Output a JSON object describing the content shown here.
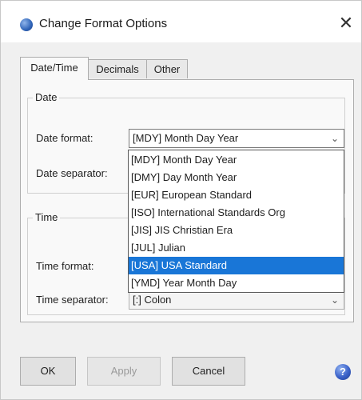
{
  "window": {
    "title": "Change Format Options",
    "close_glyph": "✕",
    "app_icon": "app-globe-icon"
  },
  "tabs": [
    {
      "label": "Date/Time",
      "active": true
    },
    {
      "label": "Decimals",
      "active": false
    },
    {
      "label": "Other",
      "active": false
    }
  ],
  "date_group": {
    "title": "Date",
    "format_label": "Date format:",
    "format_value": "[MDY] Month Day Year",
    "separator_label": "Date separator:"
  },
  "time_group": {
    "title": "Time",
    "format_label": "Time format:",
    "separator_label": "Time separator:",
    "separator_value": "[:] Colon"
  },
  "dropdown": {
    "options": [
      "[MDY] Month Day Year",
      "[DMY] Day Month Year",
      "[EUR] European Standard",
      "[ISO] International Standards Org",
      "[JIS] JIS Christian Era",
      "[JUL] Julian",
      "[USA] USA Standard",
      "[YMD] Year Month Day"
    ],
    "highlighted_index": 6
  },
  "buttons": {
    "ok": "OK",
    "apply": "Apply",
    "cancel": "Cancel",
    "help_glyph": "?"
  },
  "colors": {
    "selection": "#1976d7",
    "accent_icon": "#2f64b8"
  }
}
